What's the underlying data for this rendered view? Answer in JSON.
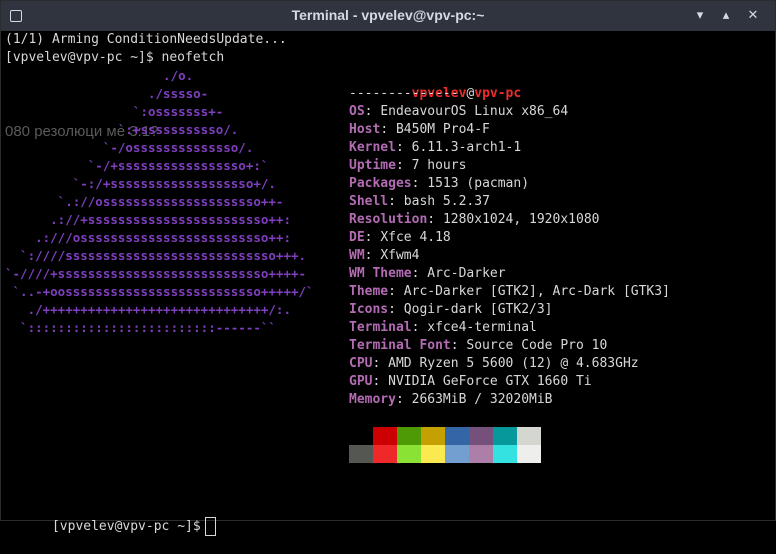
{
  "window": {
    "title": "Terminal - vpvelev@vpv-pc:~",
    "buttons": {
      "minimize": "▾",
      "maximize": "▴",
      "close": "✕"
    }
  },
  "terminal": {
    "line1": "(1/1) Arming ConditionNeedsUpdate...",
    "line2": "[vpvelev@vpv-pc ~]$ neofetch",
    "ghost_text": "080 резолюци                        ме 3:1?",
    "prompt_last": "[vpvelev@vpv-pc ~]$"
  },
  "logo": [
    "                     ./o.",
    "                   ./sssso-",
    "                 `:osssssss+-",
    "               `:+sssssssssso/.",
    "             `-/ossssssssssssso/.",
    "           `-/+sssssssssssssssso+:`",
    "         `-:/+sssssssssssssssssso+/.",
    "       `.://osssssssssssssssssssso++-",
    "      .://+ssssssssssssssssssssssso++:",
    "    .:///osssssssssssssssssssssssso++:",
    "  `:////ssssssssssssssssssssssssssso+++.",
    "`-////+ssssssssssssssssssssssssssso++++-",
    " `..-+oossssssssssssssssssssssssso+++++/`",
    "   ./++++++++++++++++++++++++++++++/:.",
    "  `:::::::::::::::::::::::::------``"
  ],
  "info": {
    "user": "vpvelev",
    "at": "@",
    "host": "vpv-pc",
    "separator": "--------------",
    "rows": [
      {
        "key": "OS",
        "value": "EndeavourOS Linux x86_64"
      },
      {
        "key": "Host",
        "value": "B450M Pro4-F"
      },
      {
        "key": "Kernel",
        "value": "6.11.3-arch1-1"
      },
      {
        "key": "Uptime",
        "value": "7 hours"
      },
      {
        "key": "Packages",
        "value": "1513 (pacman)"
      },
      {
        "key": "Shell",
        "value": "bash 5.2.37"
      },
      {
        "key": "Resolution",
        "value": "1280x1024, 1920x1080"
      },
      {
        "key": "DE",
        "value": "Xfce 4.18"
      },
      {
        "key": "WM",
        "value": "Xfwm4"
      },
      {
        "key": "WM Theme",
        "value": "Arc-Darker"
      },
      {
        "key": "Theme",
        "value": "Arc-Darker [GTK2], Arc-Dark [GTK3]"
      },
      {
        "key": "Icons",
        "value": "Qogir-dark [GTK2/3]"
      },
      {
        "key": "Terminal",
        "value": "xfce4-terminal"
      },
      {
        "key": "Terminal Font",
        "value": "Source Code Pro 10"
      },
      {
        "key": "CPU",
        "value": "AMD Ryzen 5 5600 (12) @ 4.683GHz"
      },
      {
        "key": "GPU",
        "value": "NVIDIA GeForce GTX 1660 Ti"
      },
      {
        "key": "Memory",
        "value": "2663MiB / 32020MiB"
      }
    ]
  },
  "palette_top": [
    "#000000",
    "#cc0000",
    "#4e9a06",
    "#c4a000",
    "#3465a4",
    "#75507b",
    "#06989a",
    "#d3d7cf"
  ],
  "palette_bottom": [
    "#555753",
    "#ef2929",
    "#8ae234",
    "#fce94f",
    "#729fcf",
    "#ad7fa8",
    "#34e2e2",
    "#eeeeec"
  ]
}
